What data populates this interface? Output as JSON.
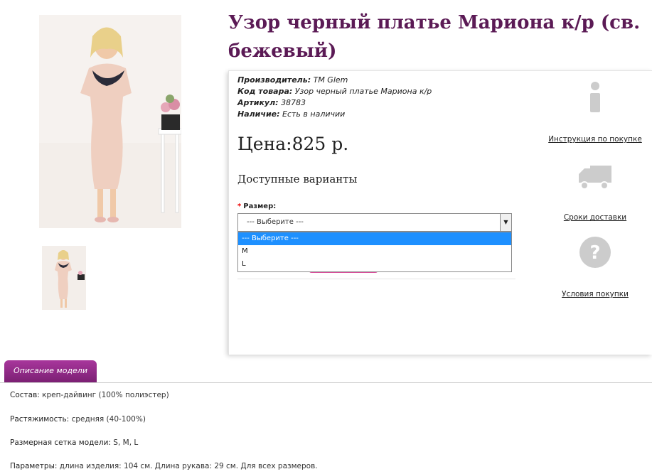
{
  "product": {
    "title": "Узор черный платье Мариона к/р (св. бежевый)",
    "meta": {
      "manufacturer_label": "Производитель:",
      "manufacturer": "TM Glem",
      "code_label": "Код товара:",
      "code": "Узор черный платье Мариона к/р",
      "article_label": "Артикул:",
      "article": "38783",
      "availability_label": "Наличие:",
      "availability": "Есть в наличии"
    },
    "price": "Цена:825 р.",
    "variants_heading": "Доступные варианты",
    "size_label": "Размер:",
    "size_required_mark": "*",
    "size_select_value": "--- Выберите ---",
    "size_options": [
      "--- Выберите ---",
      "M",
      "L"
    ]
  },
  "sidebar": {
    "instruction": "Инструкция по покупке",
    "delivery": "Сроки доставки",
    "terms": "Условия покупки"
  },
  "tabs": {
    "description": "Описание модели"
  },
  "description": {
    "composition_label": "Состав:",
    "composition": "креп-дайвинг (100% полиэстер)",
    "stretch_label": "Растяжимость:",
    "stretch": "средняя (40-100%)",
    "sizes_label": "Размерная сетка модели:",
    "sizes": "S, M, L",
    "params_label": "Параметры:",
    "params": "длина изделия: 104 см. Длина рукава: 29 см. Для всех размеров."
  },
  "colors": {
    "title": "#5b1a55",
    "tab": "#8e2885",
    "selected_option": "#1e90ff",
    "icon_gray": "#cccccc"
  }
}
